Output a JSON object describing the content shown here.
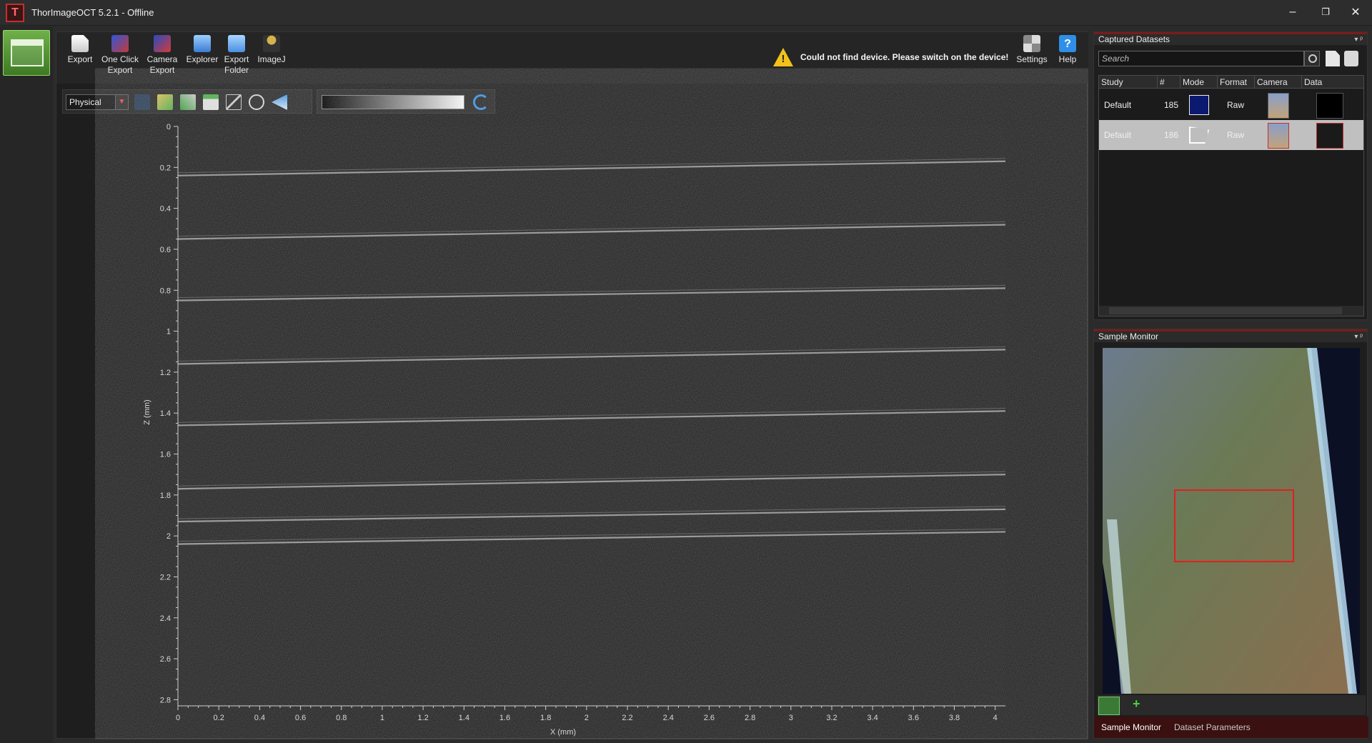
{
  "window": {
    "title": "ThorImageOCT 5.2.1 - Offline",
    "controls": {
      "minimize": "–",
      "restore": "❐",
      "close": "✕"
    }
  },
  "ribbon": {
    "buttons": [
      {
        "label": "Export"
      },
      {
        "label": "One Click\nExport"
      },
      {
        "label": "Camera\nExport"
      },
      {
        "label": "Explorer"
      },
      {
        "label": "Export\nFolder"
      },
      {
        "label": "ImageJ"
      }
    ],
    "warning": "Could not find device. Please switch on the device!",
    "settings_label": "Settings",
    "help_label": "Help",
    "help_glyph": "?"
  },
  "view_toolbar": {
    "units_value": "Physical",
    "dropdown_arrow": "▼"
  },
  "scan": {
    "x_label": "X (mm)",
    "z_label": "Z (mm)",
    "x_ticks": [
      "0",
      "0.2",
      "0.4",
      "0.6",
      "0.8",
      "1",
      "1.2",
      "1.4",
      "1.6",
      "1.8",
      "2",
      "2.2",
      "2.4",
      "2.6",
      "2.8",
      "3",
      "3.2",
      "3.4",
      "3.6",
      "3.8",
      "4"
    ],
    "z_ticks": [
      "0",
      "0.2",
      "0.4",
      "0.6",
      "0.8",
      "1",
      "1.2",
      "1.4",
      "1.6",
      "1.8",
      "2",
      "2.2",
      "2.4",
      "2.6",
      "2.8"
    ],
    "x_range": [
      0,
      4.05
    ],
    "z_range": [
      0,
      2.83
    ],
    "layers": [
      {
        "z_left": 0.24,
        "z_right": 0.17
      },
      {
        "z_left": 0.55,
        "z_right": 0.48
      },
      {
        "z_left": 0.85,
        "z_right": 0.79
      },
      {
        "z_left": 1.16,
        "z_right": 1.09
      },
      {
        "z_left": 1.46,
        "z_right": 1.39
      },
      {
        "z_left": 1.77,
        "z_right": 1.7
      },
      {
        "z_left": 1.93,
        "z_right": 1.87
      },
      {
        "z_left": 2.04,
        "z_right": 1.98
      }
    ],
    "colors": {
      "background": "#1f1f1f",
      "layer": "#bdbdbd",
      "axis": "#cfcfcf"
    }
  },
  "captured_datasets": {
    "title": "Captured Datasets",
    "search_placeholder": "Search",
    "columns": [
      "Study",
      "#",
      "Mode",
      "Format",
      "Camera",
      "Data"
    ],
    "rows": [
      {
        "study": "Default",
        "number": "185",
        "format": "Raw",
        "selected": false
      },
      {
        "study": "Default",
        "number": "186",
        "format": "Raw",
        "selected": true
      }
    ],
    "pin_glyph": "▾ ᵖ"
  },
  "sample_monitor": {
    "title": "Sample Monitor",
    "add_glyph": "+",
    "tabs": [
      "Sample Monitor",
      "Dataset Parameters"
    ],
    "pin_glyph": "▾ ᵖ"
  }
}
